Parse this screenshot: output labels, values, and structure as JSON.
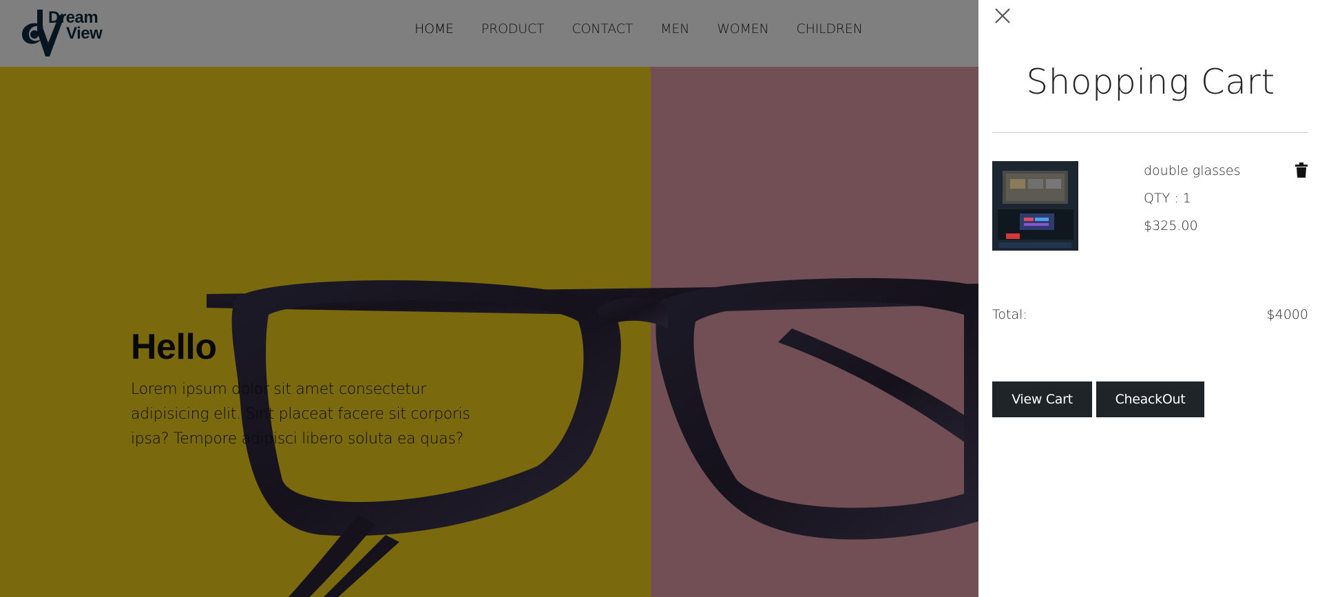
{
  "brand": {
    "name_line1": "Dream",
    "name_line2": "View",
    "color": "#0d2a3e",
    "logo_icon": "eye-logo-icon"
  },
  "nav": {
    "items": [
      {
        "label": "HOME",
        "active": true
      },
      {
        "label": "PRODUCT",
        "active": false
      },
      {
        "label": "CONTACT",
        "active": false
      },
      {
        "label": "MEN",
        "active": false
      },
      {
        "label": "WOMEN",
        "active": false
      },
      {
        "label": "CHILDREN",
        "active": false
      }
    ]
  },
  "hero": {
    "title": "Hello",
    "body": "Lorem ipsum dolor sit amet consectetur adipisicing elit. Sint placeat facere sit corporis ipsa? Tempore adipisci libero soluta ea quas?",
    "colors": {
      "yellow": "#f7d21c",
      "pink": "#e59cab",
      "overlay": "rgba(0,0,0,0.5)"
    }
  },
  "cart": {
    "close_icon": "close-icon",
    "title": "Shopping Cart",
    "items": [
      {
        "name": "double glasses",
        "qty": "QTY : 1",
        "price": "$325.00",
        "delete_icon": "trash-icon"
      }
    ],
    "total_label": "Total:",
    "total_value": "$4000",
    "view_cart_label": "View Cart",
    "checkout_label": "CheackOut",
    "button_color": "#1f2428"
  }
}
